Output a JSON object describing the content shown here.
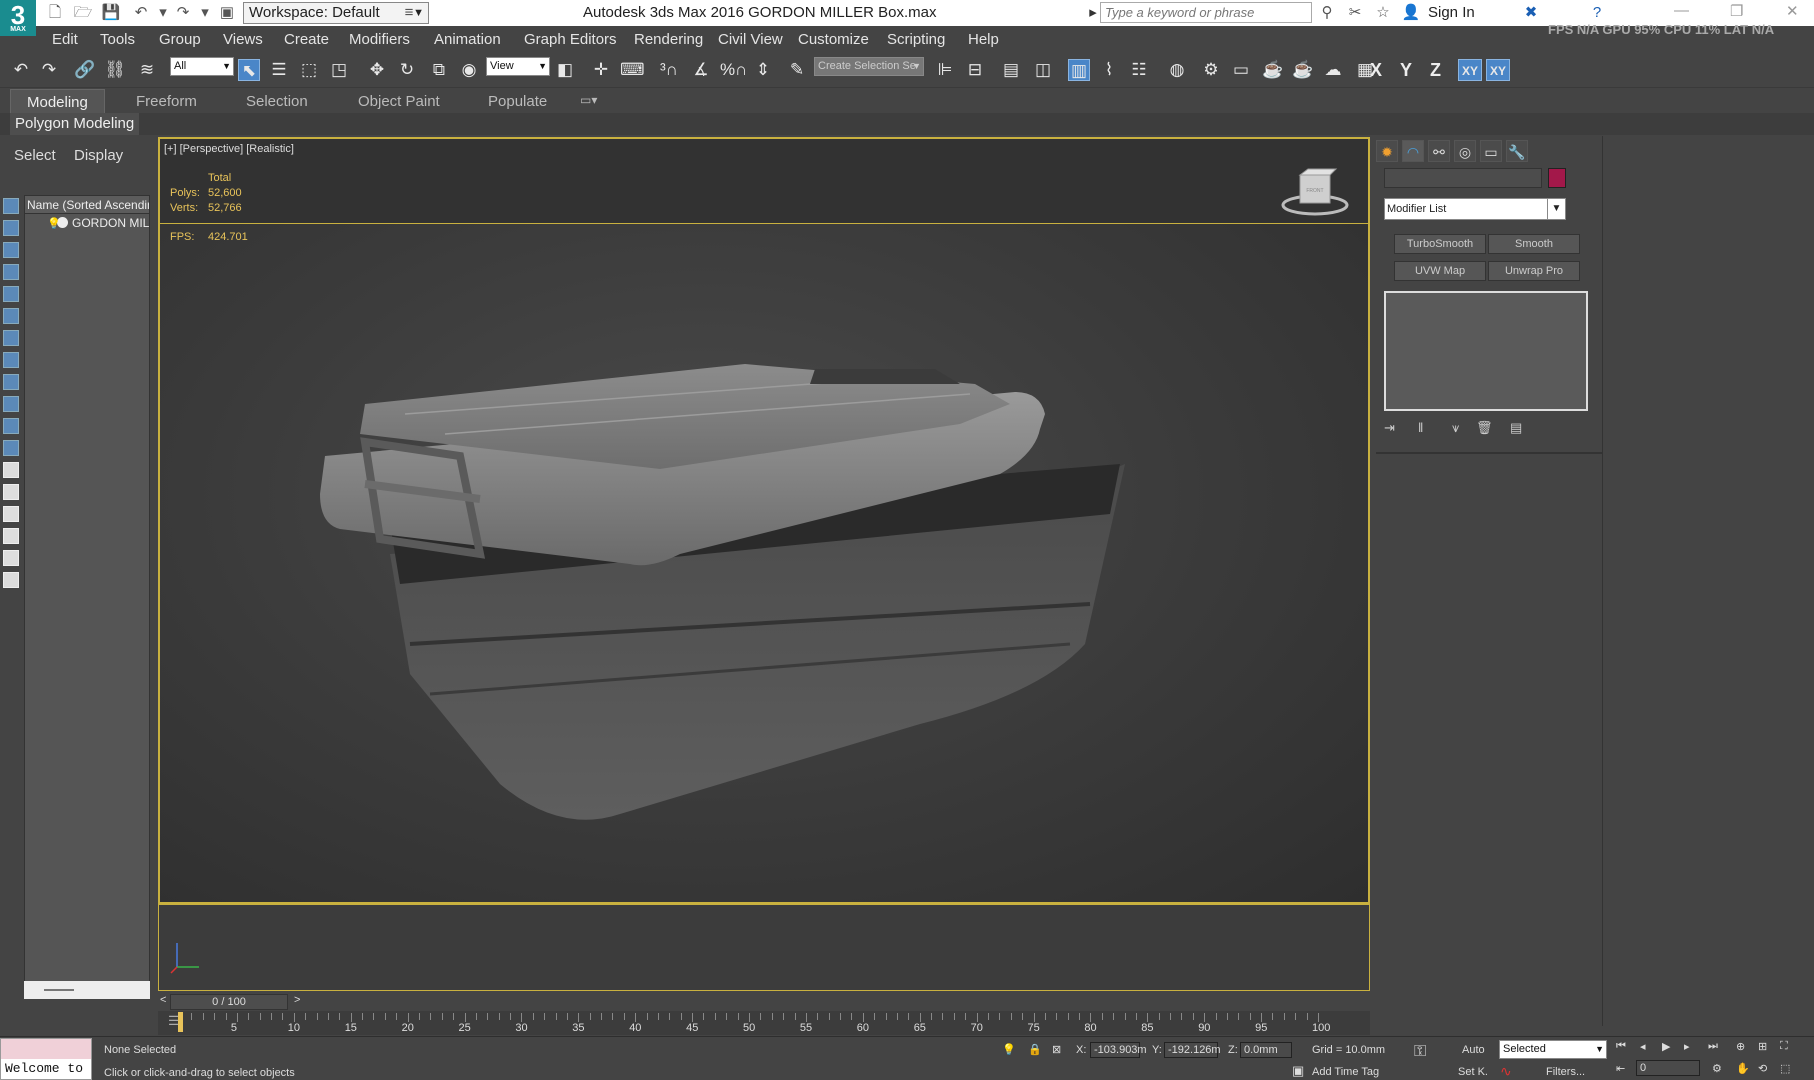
{
  "title_bar": {
    "app_logo": "3",
    "app_logo_sub": "MAX",
    "workspace": "Workspace: Default",
    "window_title": "Autodesk 3ds Max 2016    GORDON MILLER Box.max",
    "search_placeholder": "Type a keyword or phrase",
    "sign_in": "Sign In",
    "stats": "FPS N/A GPU 95% CPU 11% LAT N/A"
  },
  "menu": [
    "Edit",
    "Tools",
    "Group",
    "Views",
    "Create",
    "Modifiers",
    "Animation",
    "Graph Editors",
    "Rendering",
    "Civil View",
    "Customize",
    "Scripting",
    "Help"
  ],
  "toolbar": {
    "filter_dropdown": "All",
    "ref_coord_dropdown": "View",
    "selection_set": "Create Selection Se",
    "axis_x": "X",
    "axis_y": "Y",
    "axis_z": "Z",
    "axis_xy": "XY",
    "axis_xy2": "XY"
  },
  "ribbon": {
    "tabs": [
      "Modeling",
      "Freeform",
      "Selection",
      "Object Paint",
      "Populate"
    ],
    "active_panel": "Polygon Modeling"
  },
  "scene_explorer": {
    "tabs": [
      "Select",
      "Display"
    ],
    "column_header": "Name (Sorted Ascending)",
    "items": [
      "GORDON MILLER Box"
    ]
  },
  "viewport": {
    "label": "[+] [Perspective] [Realistic]",
    "stats_total": "Total",
    "polys_label": "Polys:",
    "polys_value": "52,600",
    "verts_label": "Verts:",
    "verts_value": "52,766",
    "fps_label": "FPS:",
    "fps_value": "424.701",
    "viewcube_face": "FRONT"
  },
  "timeline": {
    "slider": "0 / 100",
    "prev": "<",
    "next": ">",
    "ticks": [
      "0",
      "5",
      "10",
      "15",
      "20",
      "25",
      "30",
      "35",
      "40",
      "45",
      "50",
      "55",
      "60",
      "65",
      "70",
      "75",
      "80",
      "85",
      "90",
      "95",
      "100"
    ]
  },
  "status_bar": {
    "welcome": "Welcome to",
    "selection_status": "None Selected",
    "prompt": "Click or click-and-drag to select objects",
    "x_label": "X:",
    "x_value": "-103.903m",
    "y_label": "Y:",
    "y_value": "-192.126m",
    "z_label": "Z:",
    "z_value": "0.0mm",
    "grid": "Grid = 10.0mm",
    "add_time_tag": "Add Time Tag",
    "auto": "Auto",
    "set_key": "Set K.",
    "key_filter_dropdown": "Selected",
    "filters": "Filters...",
    "frame_value": "0"
  },
  "command_panel": {
    "modifier_list": "Modifier List",
    "buttons": [
      "TurboSmooth",
      "Smooth",
      "UVW Map",
      "Unwrap Pro"
    ],
    "object_color": "#a3184a"
  },
  "colors": {
    "viewport_border": "#c9b13f",
    "active_tool": "#4a86c8",
    "stats_text": "#e8c35a"
  }
}
